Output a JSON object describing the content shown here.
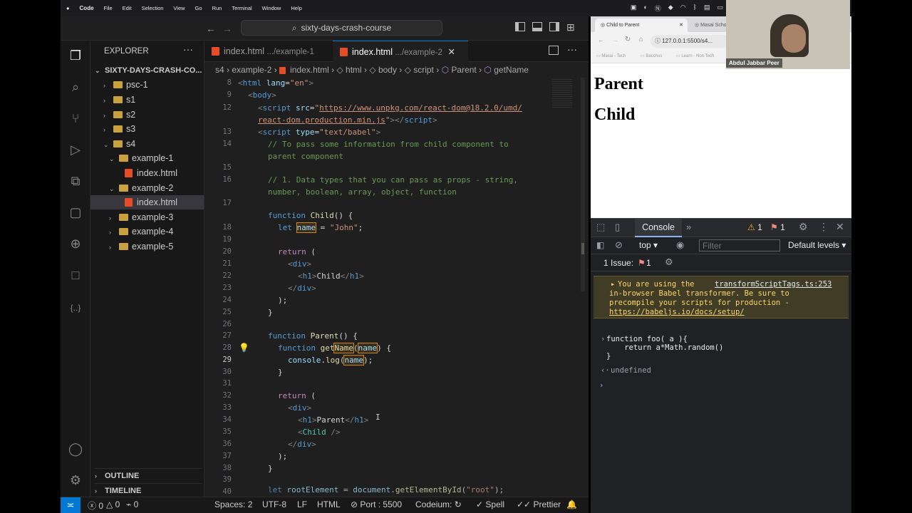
{
  "menubar": {
    "app": "Code",
    "items": [
      "File",
      "Edit",
      "Selection",
      "View",
      "Go",
      "Run",
      "Terminal",
      "Window",
      "Help"
    ]
  },
  "vscode": {
    "search_text": "sixty-days-crash-course",
    "explorer_title": "EXPLORER",
    "project_root": "SIXTY-DAYS-CRASH-CO...",
    "tree": [
      {
        "label": "psc-1",
        "type": "folder"
      },
      {
        "label": "s1",
        "type": "folder"
      },
      {
        "label": "s2",
        "type": "folder"
      },
      {
        "label": "s3",
        "type": "folder"
      },
      {
        "label": "s4",
        "type": "folder-open"
      },
      {
        "label": "example-1",
        "type": "folder-open"
      },
      {
        "label": "index.html",
        "type": "file"
      },
      {
        "label": "example-2",
        "type": "folder-open"
      },
      {
        "label": "index.html",
        "type": "file"
      },
      {
        "label": "example-3",
        "type": "folder"
      },
      {
        "label": "example-4",
        "type": "folder"
      },
      {
        "label": "example-5",
        "type": "folder"
      }
    ],
    "outline_label": "OUTLINE",
    "timeline_label": "TIMELINE",
    "tabs": [
      {
        "name": "index.html",
        "path": ".../example-1"
      },
      {
        "name": "index.html",
        "path": ".../example-2"
      }
    ],
    "breadcrumbs": [
      "s4",
      "example-2",
      "index.html",
      "html",
      "body",
      "script",
      "Parent",
      "getName"
    ],
    "line_numbers": [
      "8",
      "9",
      "12",
      "",
      "13",
      "14",
      "",
      "15",
      "16",
      "",
      "17",
      "18",
      "19",
      "20",
      "21",
      "22",
      "23",
      "24",
      "25",
      "26",
      "27",
      "28",
      "29",
      "30",
      "31",
      "32",
      "33",
      "34",
      "35",
      "36",
      "37",
      "38",
      "39",
      "40"
    ],
    "status": {
      "errors": "0",
      "warnings": "0",
      "ports": "0",
      "spaces": "Spaces: 2",
      "encoding": "UTF-8",
      "eol": "LF",
      "language": "HTML",
      "port": "Port : 5500",
      "codeium": "Codeium:",
      "spell": "Spell",
      "prettier": "Prettier"
    }
  },
  "browser": {
    "tab1": "Child to Parent",
    "tab2": "Masai Scho",
    "url": "127.0.0.1:5500/s4...",
    "bookmarks": [
      "Masai - Tech",
      "Bacchus",
      "Learn - Non Tech"
    ],
    "page_h1_parent": "Parent",
    "page_h1_child": "Child",
    "devtools": {
      "console_tab": "Console",
      "warn_count": "1",
      "issue_count": "1",
      "context": "top",
      "filter_placeholder": "Filter",
      "levels": "Default levels",
      "issues_label": "1 Issue:",
      "issues_num": "1",
      "warning_line1": "You are using the",
      "warning_source": "transformScriptTags.ts:253",
      "warning_line2": "in-browser Babel transformer. Be sure to",
      "warning_line3": "precompile your scripts for production -",
      "warning_link": "https://babeljs.io/docs/setup/",
      "input_line1": "function foo( a ){",
      "input_line2": "    return a*Math.random()",
      "input_line3": "}",
      "result": "undefined"
    }
  },
  "webcam": {
    "name": "Abdul Jabbar Peer"
  },
  "colors": {
    "accent": "#0078d4",
    "editor_bg": "#1f1f1f",
    "warning_bg": "#413c26"
  }
}
